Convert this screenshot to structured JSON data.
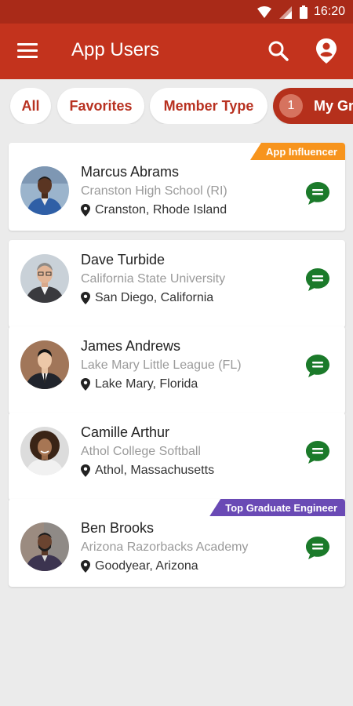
{
  "status_bar": {
    "time": "16:20"
  },
  "app_bar": {
    "title": "App Users"
  },
  "filters": {
    "all": "All",
    "favorites": "Favorites",
    "member_type": "Member Type",
    "my_group_count": "1",
    "my_group": "My Gr"
  },
  "users": [
    {
      "name": "Marcus Abrams",
      "school": "Cranston High School (RI)",
      "location": "Cranston, Rhode Island",
      "badge": "App Influencer"
    },
    {
      "name": "Dave Turbide",
      "school": "California State University",
      "location": "San Diego, California"
    },
    {
      "name": "James Andrews",
      "school": "Lake Mary Little League (FL)",
      "location": "Lake Mary, Florida"
    },
    {
      "name": "Camille Arthur",
      "school": "Athol College Softball",
      "location": "Athol, Massachusetts"
    },
    {
      "name": "Ben Brooks",
      "school": "Arizona Razorbacks Academy",
      "location": "Goodyear, Arizona",
      "badge": "Top Graduate Engineer"
    }
  ],
  "colors": {
    "primary": "#c3331d",
    "status_bar": "#a92a18",
    "badge_orange": "#f7941d",
    "badge_purple": "#6a4ab5",
    "chat_green": "#1b7a2a"
  },
  "icons": {
    "menu": "hamburger-menu-icon",
    "search": "search-icon",
    "profile": "location-pin-icon",
    "chat": "chat-bubble-icon",
    "location": "map-pin-icon"
  }
}
